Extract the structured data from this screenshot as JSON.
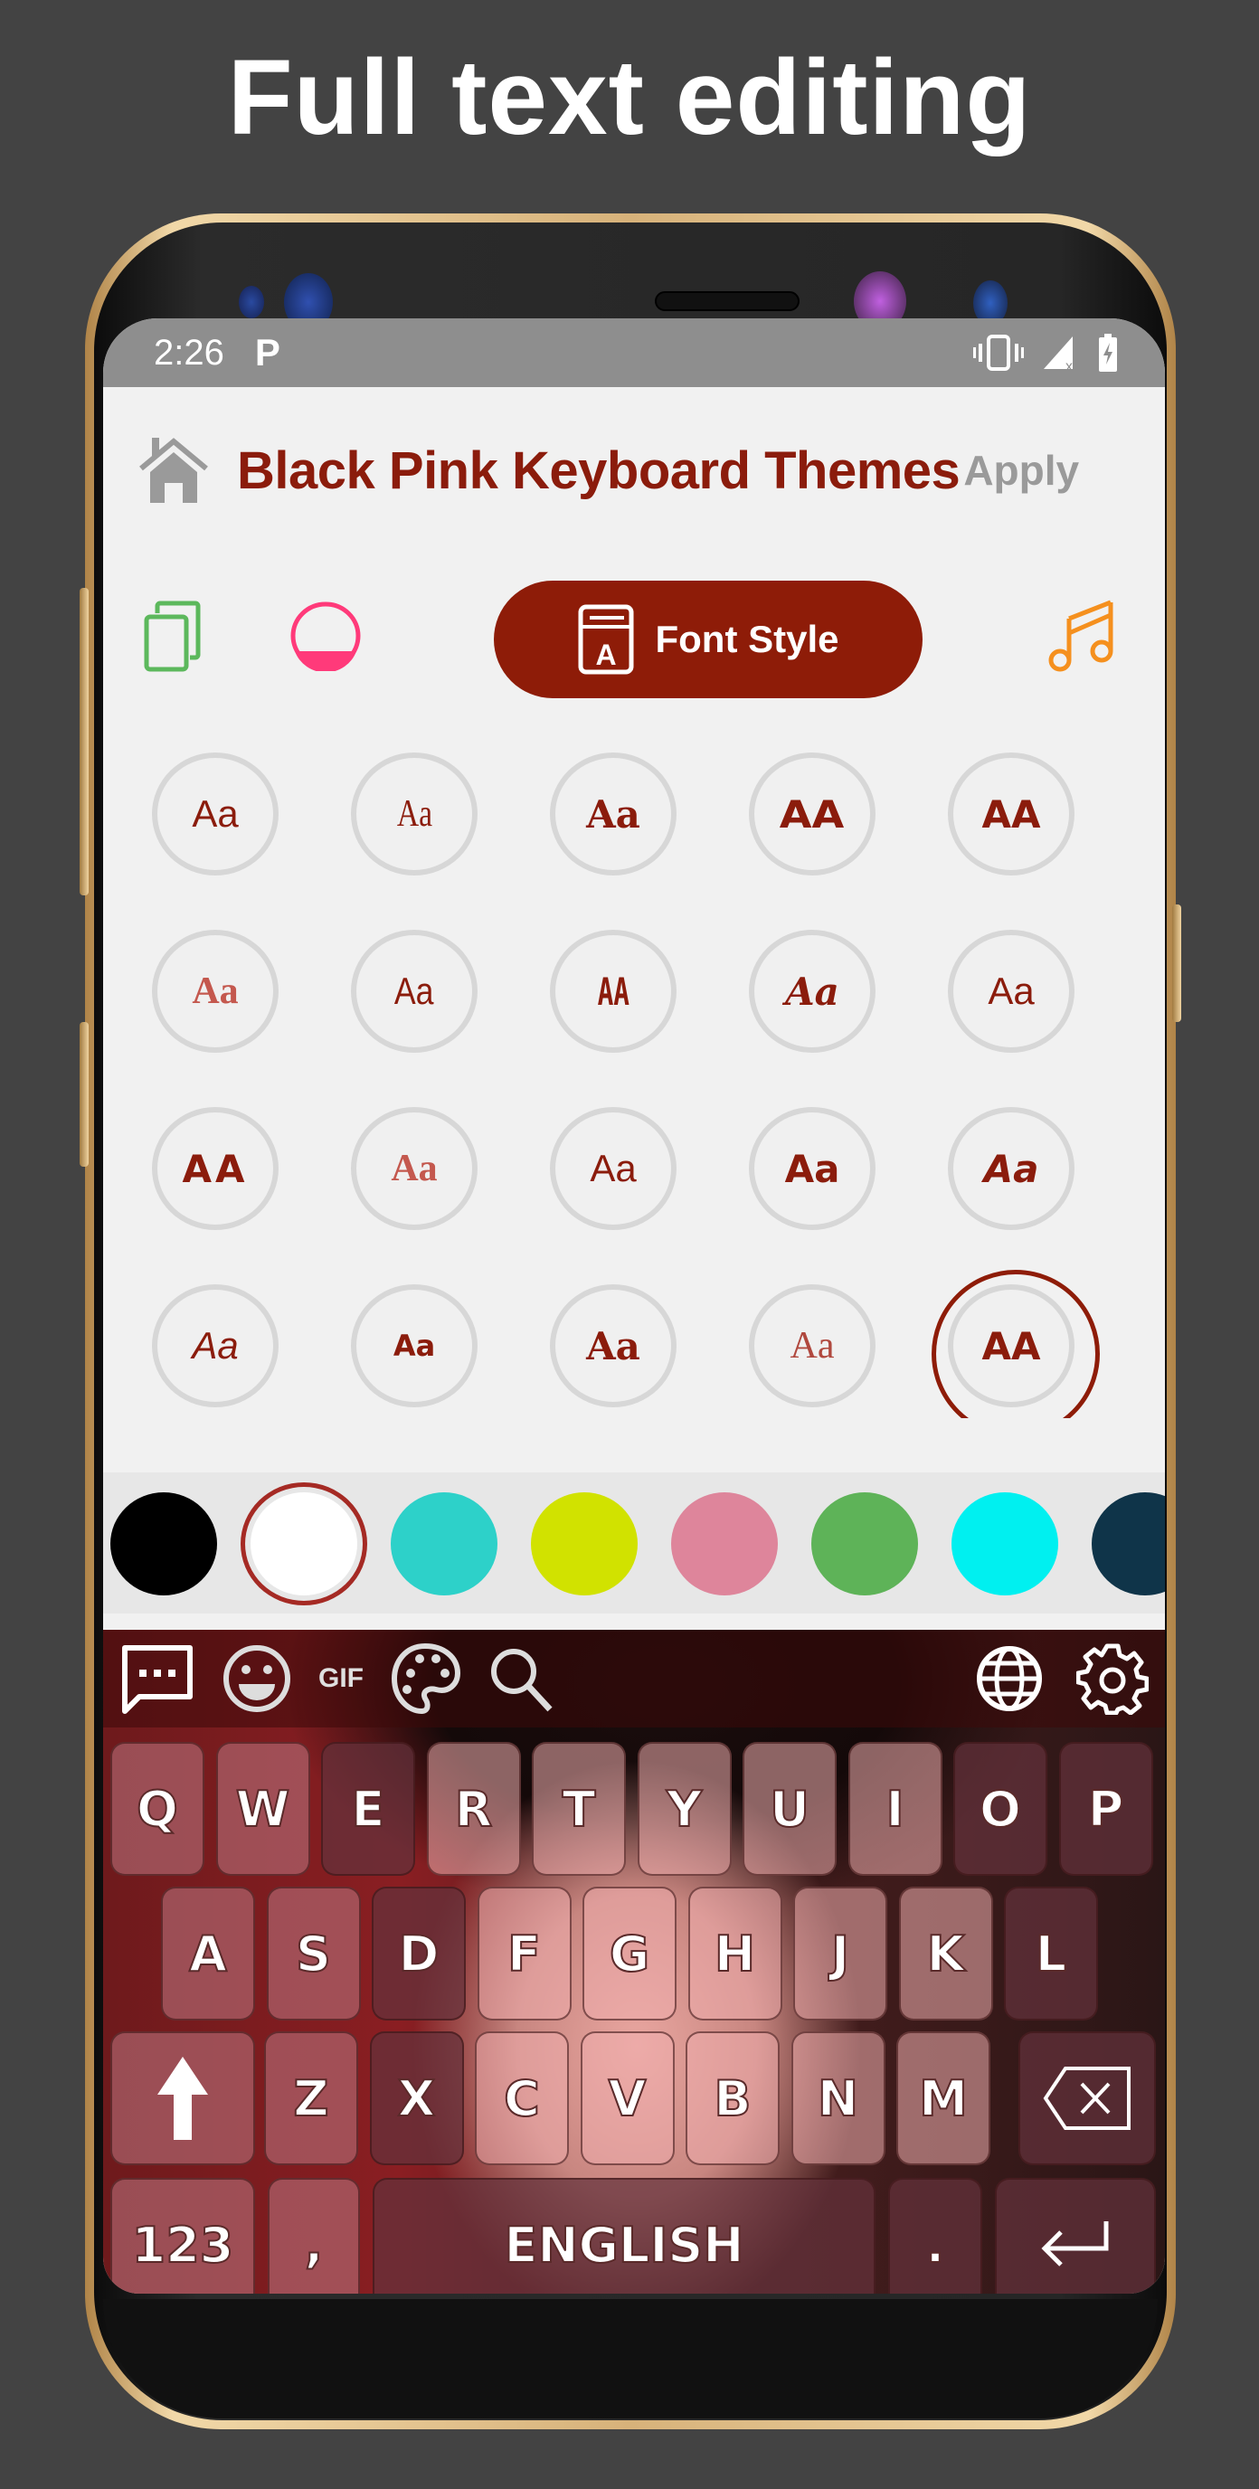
{
  "headline": "Full text editing",
  "status_bar": {
    "time": "2:26",
    "notification_icon": "P",
    "icons": [
      "vibrate-icon",
      "signal-no-data-icon",
      "battery-charging-icon"
    ]
  },
  "app_bar": {
    "home_icon": "home-icon",
    "title": "Black Pink Keyboard Themes",
    "apply_label": "Apply"
  },
  "tabs": {
    "items": [
      {
        "name": "backgrounds",
        "icon": "copy-icon",
        "color": "#5cb85c"
      },
      {
        "name": "keys",
        "icon": "half-filled-circle-icon",
        "color": "#ff3a7a"
      },
      {
        "name": "font-style",
        "icon": "font-book-icon",
        "label": "Font Style",
        "active": true,
        "color": "#8e1c08"
      },
      {
        "name": "sounds",
        "icon": "music-note-icon",
        "color": "#f5901e"
      }
    ]
  },
  "font_grid": {
    "rows": [
      [
        "Aa",
        "Aa",
        "Aa",
        "AA",
        "AA"
      ],
      [
        "Aa",
        "Aa",
        "AA",
        "Aa",
        "Aa"
      ],
      [
        "AA",
        "Aa",
        "Aa",
        "Aa",
        "Aa"
      ],
      [
        "Aa",
        "Aa",
        "Aa",
        "Aa",
        "AA"
      ]
    ],
    "selected_row": 3,
    "selected_col": 4,
    "text_color": "#8b1c0c"
  },
  "color_palette": {
    "swatches": [
      "#000000",
      "#ffffff",
      "#2dd1c9",
      "#d1e200",
      "#de859b",
      "#5eb358",
      "#00f0f0",
      "#0f3449"
    ],
    "selected_index": 1
  },
  "keyboard": {
    "toolbar_left": [
      "chat-icon",
      "emoji-icon",
      "GIF",
      "palette-icon",
      "search-icon"
    ],
    "toolbar_right": [
      "globe-icon",
      "settings-icon"
    ],
    "gif_label": "GIF",
    "row1": [
      "Q",
      "W",
      "E",
      "R",
      "T",
      "Y",
      "U",
      "I",
      "O",
      "P"
    ],
    "row2": [
      "A",
      "S",
      "D",
      "F",
      "G",
      "H",
      "J",
      "K",
      "L"
    ],
    "row3": [
      "Z",
      "X",
      "C",
      "V",
      "B",
      "N",
      "M"
    ],
    "shift_icon": "shift-arrow-icon",
    "backspace_icon": "backspace-icon",
    "numbers_label": "123",
    "comma_label": ",",
    "space_label": "ENGLISH",
    "period_label": ".",
    "enter_icon": "enter-icon"
  }
}
